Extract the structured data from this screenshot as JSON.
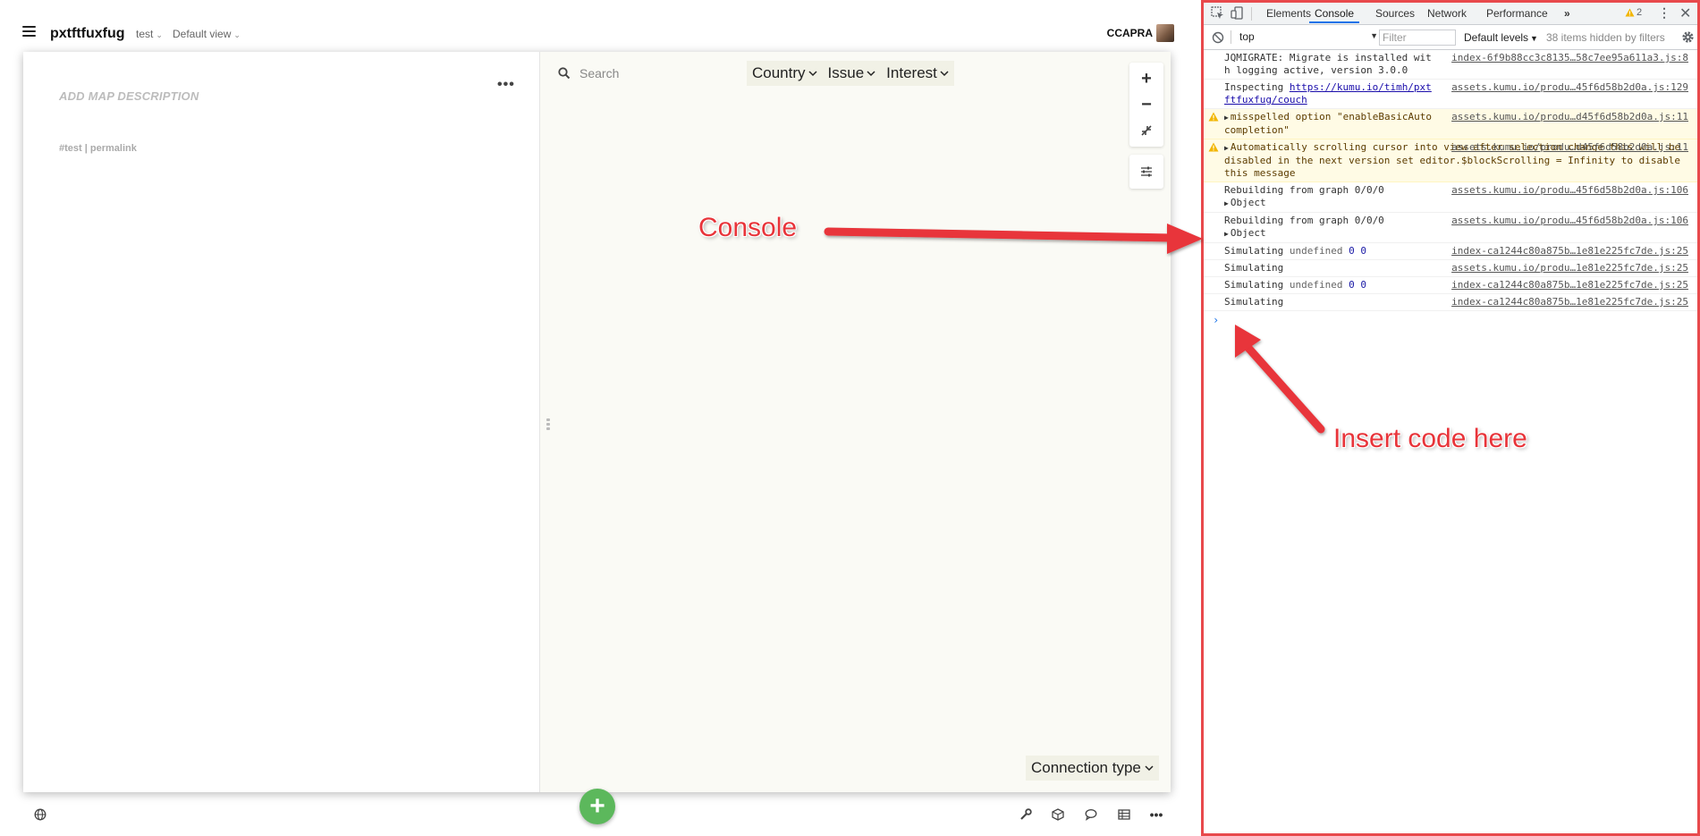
{
  "header": {
    "title": "pxtftfuxfug",
    "project": "test",
    "view": "Default view",
    "user": "CCAPRA"
  },
  "sidebar": {
    "description_placeholder": "ADD MAP DESCRIPTION",
    "links": "#test | permalink",
    "more": "•••"
  },
  "map": {
    "search_placeholder": "Search",
    "filters": [
      "Country",
      "Issue",
      "Interest"
    ],
    "connection_type": "Connection type",
    "zoom_in": "+",
    "zoom_out": "−"
  },
  "fab": {
    "label": "+"
  },
  "devtools": {
    "tabs": [
      "Elements",
      "Console",
      "Sources",
      "Network",
      "Performance"
    ],
    "active_tab": "Console",
    "warning_count": "2",
    "context": "top",
    "filter_placeholder": "Filter",
    "levels": "Default levels",
    "hidden_note": "38 items hidden by filters",
    "logs": [
      {
        "type": "log",
        "msg": "JQMIGRATE: Migrate is installed with logging active, version 3.0.0",
        "src": "index-6f9b88cc3c8135…58c7ee95a611a3.js:8"
      },
      {
        "type": "log",
        "msg_prefix": "Inspecting ",
        "msg_link": "https://kumu.io/timh/pxtftfuxfug/couch",
        "src": "assets.kumu.io/produ…45f6d58b2d0a.js:129"
      },
      {
        "type": "warn",
        "msg": "misspelled option \"enableBasicAutocompletion\"",
        "src": "assets.kumu.io/produ…d45f6d58b2d0a.js:11"
      },
      {
        "type": "warn",
        "msg": "Automatically scrolling cursor into view after selection change this will be disabled in the next version set editor.$blockScrolling = Infinity to disable this message",
        "src": "assets.kumu.io/produ…d45f6d58b2d0a.js:11"
      },
      {
        "type": "log",
        "msg": "Rebuilding from graph 0/0/0",
        "sub": "Object",
        "src": "assets.kumu.io/produ…45f6d58b2d0a.js:106"
      },
      {
        "type": "log",
        "msg": "Rebuilding from graph 0/0/0",
        "sub": "Object",
        "src": "assets.kumu.io/produ…45f6d58b2d0a.js:106"
      },
      {
        "type": "log",
        "msg": "Simulating",
        "undef": "undefined",
        "n1": "0",
        "n2": "0",
        "src": "index-ca1244c80a875b…1e81e225fc7de.js:25"
      },
      {
        "type": "log",
        "msg": "Simulating",
        "src": "assets.kumu.io/produ…1e81e225fc7de.js:25"
      },
      {
        "type": "log",
        "msg": "Simulating",
        "undef": "undefined",
        "n1": "0",
        "n2": "0",
        "src": "index-ca1244c80a875b…1e81e225fc7de.js:25"
      },
      {
        "type": "log",
        "msg": "Simulating",
        "src": "index-ca1244c80a875b…1e81e225fc7de.js:25"
      }
    ],
    "prompt": "›"
  },
  "annotations": {
    "console_label": "Console",
    "insert_label": "Insert code here",
    "color": "#e8343a"
  }
}
